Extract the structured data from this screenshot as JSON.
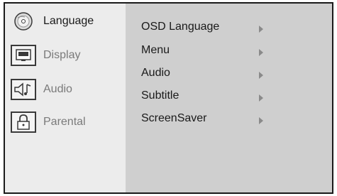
{
  "sidebar": {
    "items": [
      {
        "label": "Language",
        "icon": "language-disc-icon",
        "active": true
      },
      {
        "label": "Display",
        "icon": "display-monitor-icon",
        "active": false
      },
      {
        "label": "Audio",
        "icon": "audio-speaker-icon",
        "active": false
      },
      {
        "label": "Parental",
        "icon": "parental-lock-icon",
        "active": false
      }
    ]
  },
  "submenu": {
    "items": [
      {
        "label": "OSD Language"
      },
      {
        "label": "Menu"
      },
      {
        "label": "Audio"
      },
      {
        "label": "Subtitle"
      },
      {
        "label": "ScreenSaver"
      }
    ]
  },
  "colors": {
    "sidebar_bg": "#ececec",
    "content_bg": "#cfcfcf",
    "border": "#1a1a1a",
    "active_text": "#1a1a1a",
    "inactive_text": "#7a7a7a",
    "arrow": "#8a8a8a"
  }
}
